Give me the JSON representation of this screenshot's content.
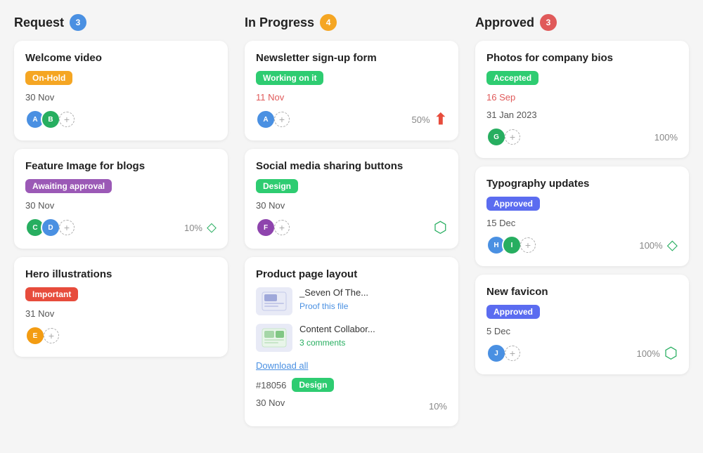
{
  "columns": [
    {
      "id": "request",
      "title": "Request",
      "badge": "3",
      "badge_color": "badge-blue",
      "cards": [
        {
          "id": "welcome-video",
          "title": "Welcome video",
          "tag": "On-Hold",
          "tag_class": "tag-onhold",
          "date": "30 Nov",
          "date_class": "card-date-dark",
          "avatars": [
            "blue",
            "teal"
          ],
          "show_percent": false,
          "percent": "",
          "icon": ""
        },
        {
          "id": "feature-image",
          "title": "Feature Image for blogs",
          "tag": "Awaiting approval",
          "tag_class": "tag-awaiting",
          "date": "30 Nov",
          "date_class": "card-date-dark",
          "avatars": [
            "teal",
            "blue"
          ],
          "show_percent": true,
          "percent": "10%",
          "icon": "arrow-down"
        },
        {
          "id": "hero-illustrations",
          "title": "Hero illustrations",
          "tag": "Important",
          "tag_class": "tag-important",
          "date": "31 Nov",
          "date_class": "card-date-dark",
          "avatars": [
            "orange"
          ],
          "show_percent": false,
          "percent": "",
          "icon": ""
        }
      ]
    },
    {
      "id": "in-progress",
      "title": "In Progress",
      "badge": "4",
      "badge_color": "badge-orange",
      "cards": [
        {
          "id": "newsletter",
          "title": "Newsletter sign-up form",
          "tag": "Working on it",
          "tag_class": "tag-working",
          "date": "11 Nov",
          "date_class": "card-date",
          "avatars": [
            "blue"
          ],
          "show_percent": true,
          "percent": "50%",
          "icon": "arrow-up"
        },
        {
          "id": "social-media",
          "title": "Social media sharing buttons",
          "tag": "Design",
          "tag_class": "tag-design",
          "date": "30 Nov",
          "date_class": "card-date-dark",
          "avatars": [
            "purple"
          ],
          "show_percent": false,
          "percent": "",
          "icon": "dots-green"
        },
        {
          "id": "product-page",
          "title": "Product page layout",
          "tag": "",
          "tag_class": "",
          "date": "30 Nov",
          "date_class": "card-date-dark",
          "avatars": [],
          "show_percent": true,
          "percent": "10%",
          "icon": "",
          "is_files_card": true,
          "tag_row_id": "#18056",
          "tag_row_label": "Design",
          "files": [
            {
              "name": "_Seven Of The...",
              "link": "Proof this file",
              "link_class": "file-link"
            },
            {
              "name": "Content Collabor...",
              "link": "3 comments",
              "link_class": "file-link file-link-green"
            }
          ],
          "download_label": "Download all"
        }
      ]
    },
    {
      "id": "approved",
      "title": "Approved",
      "badge": "3",
      "badge_color": "badge-red",
      "cards": [
        {
          "id": "photos-bios",
          "title": "Photos for company bios",
          "tag": "Accepted",
          "tag_class": "tag-accepted",
          "date_red": "16 Sep",
          "date_dark": "31 Jan 2023",
          "date_class": "card-date",
          "avatars": [
            "teal"
          ],
          "show_percent": true,
          "percent": "100%",
          "icon": ""
        },
        {
          "id": "typography",
          "title": "Typography updates",
          "tag": "Approved",
          "tag_class": "tag-approved",
          "date": "15 Dec",
          "date_class": "card-date-dark",
          "avatars": [
            "blue",
            "teal"
          ],
          "show_percent": true,
          "percent": "100%",
          "icon": "arrow-down"
        },
        {
          "id": "new-favicon",
          "title": "New favicon",
          "tag": "Approved",
          "tag_class": "tag-approved",
          "date": "5 Dec",
          "date_class": "card-date-dark",
          "avatars": [
            "blue"
          ],
          "show_percent": true,
          "percent": "100%",
          "icon": "dots-green"
        }
      ]
    }
  ]
}
